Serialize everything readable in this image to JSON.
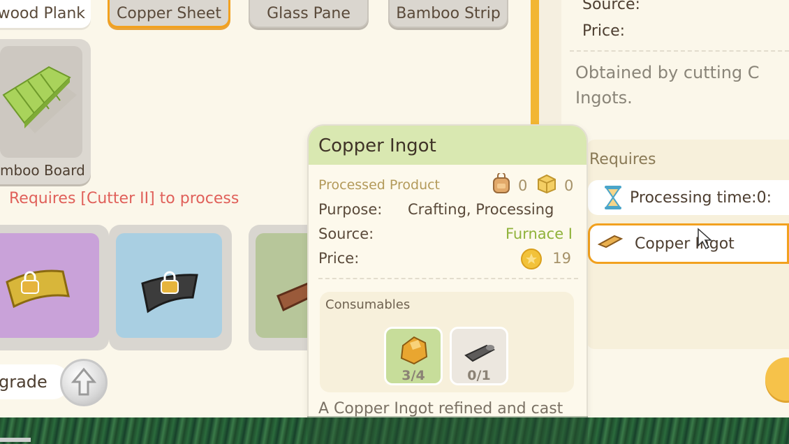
{
  "top_tabs": [
    {
      "label": "twood Plank",
      "style": "white"
    },
    {
      "label": "Copper Sheet",
      "style": "selected"
    },
    {
      "label": "Glass Pane",
      "style": "gray"
    },
    {
      "label": "Bamboo Strip",
      "style": "gray"
    }
  ],
  "bamboo_card": {
    "label": "mboo Board"
  },
  "requirement_notice": "Requires [Cutter II] to process",
  "locked_items": [
    {
      "name": "gold-sheet",
      "color": "#c9a2d9"
    },
    {
      "name": "iron-sheet",
      "color": "#a9cfe2"
    },
    {
      "name": "copper-sheet",
      "color": "#b7c69a"
    }
  ],
  "upgrade": {
    "label": "grade"
  },
  "detail_panel": {
    "source_label": "Source:",
    "price_label": "Price:",
    "description": "Obtained by cutting C Ingots.",
    "requires_title": "Requires",
    "processing_time": "Processing time:0:",
    "required_item": "Copper Ingot"
  },
  "tooltip": {
    "title": "Copper Ingot",
    "category": "Processed Product",
    "bag_count": "0",
    "box_count": "0",
    "purpose_label": "Purpose:",
    "purpose_value": "Crafting, Processing",
    "source_label": "Source:",
    "source_value": "Furnace I",
    "price_label": "Price:",
    "price_value": "19",
    "consumables_title": "Consumables",
    "consumables": [
      {
        "name": "copper-ore",
        "count": "3/4"
      },
      {
        "name": "coal",
        "count": "0/1"
      }
    ],
    "description": "A Copper Ingot refined and cast from copper ore. Every"
  },
  "colors": {
    "accent": "#f2a11f",
    "warning": "#e0605a",
    "source_green": "#8fb23a",
    "header_green": "#d9e8b1"
  }
}
